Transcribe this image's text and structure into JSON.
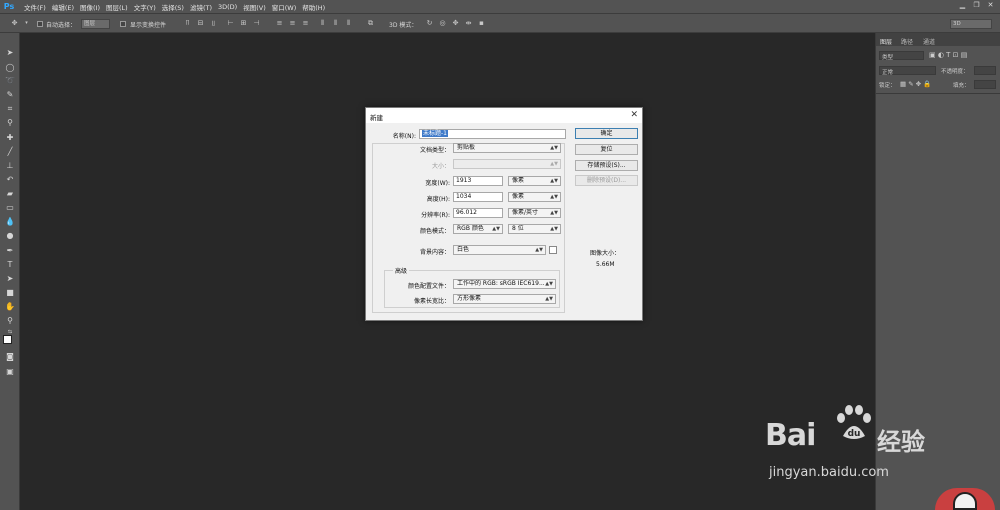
{
  "app": {
    "logo": "Ps"
  },
  "menu": [
    "文件(F)",
    "编辑(E)",
    "图像(I)",
    "图层(L)",
    "文字(Y)",
    "选择(S)",
    "滤镜(T)",
    "3D(D)",
    "视图(V)",
    "窗口(W)",
    "帮助(H)"
  ],
  "window_controls": {
    "minimize": "▁",
    "restore": "❐",
    "close": "✕"
  },
  "options_bar": {
    "auto_select": "自动选择：",
    "auto_select_value": "图层",
    "show_transform": "显示变换控件",
    "mode_3d": "3D 模式：",
    "workspace": "3D"
  },
  "panel": {
    "tabs": [
      "图层",
      "路径",
      "通道"
    ],
    "kind_filter": "类型",
    "blend_mode": "正常",
    "opacity_label": "不透明度：",
    "lock_label": "锁定：",
    "fill_label": "填充："
  },
  "dialog": {
    "title": "新建",
    "close": "✕",
    "name_label": "名称(N):",
    "name_value": "未标题-1",
    "preset_label": "文档类型：",
    "preset_value": "剪贴板",
    "size_label": "大小：",
    "width_label": "宽度(W):",
    "width_value": "1913",
    "width_unit": "像素",
    "height_label": "高度(H):",
    "height_value": "1034",
    "height_unit": "像素",
    "resolution_label": "分辨率(R):",
    "resolution_value": "96.012",
    "resolution_unit": "像素/英寸",
    "color_mode_label": "颜色模式：",
    "color_mode_value": "RGB 颜色",
    "bit_depth_value": "8 位",
    "background_label": "背景内容：",
    "background_value": "白色",
    "advanced_label": "高级",
    "color_profile_label": "颜色配置文件：",
    "color_profile_value": "工作中的 RGB: sRGB IEC619...",
    "pixel_aspect_label": "像素长宽比：",
    "pixel_aspect_value": "方形像素",
    "ok_button": "确定",
    "reset_button": "复位",
    "save_preset_button": "存储预设(S)...",
    "delete_preset_button": "删除预设(D)...",
    "image_size_label": "图像大小：",
    "image_size_value": "5.66M"
  },
  "watermark": {
    "brand": "Bai",
    "brand_cn": "经验",
    "url": "jingyan.baidu.com"
  }
}
